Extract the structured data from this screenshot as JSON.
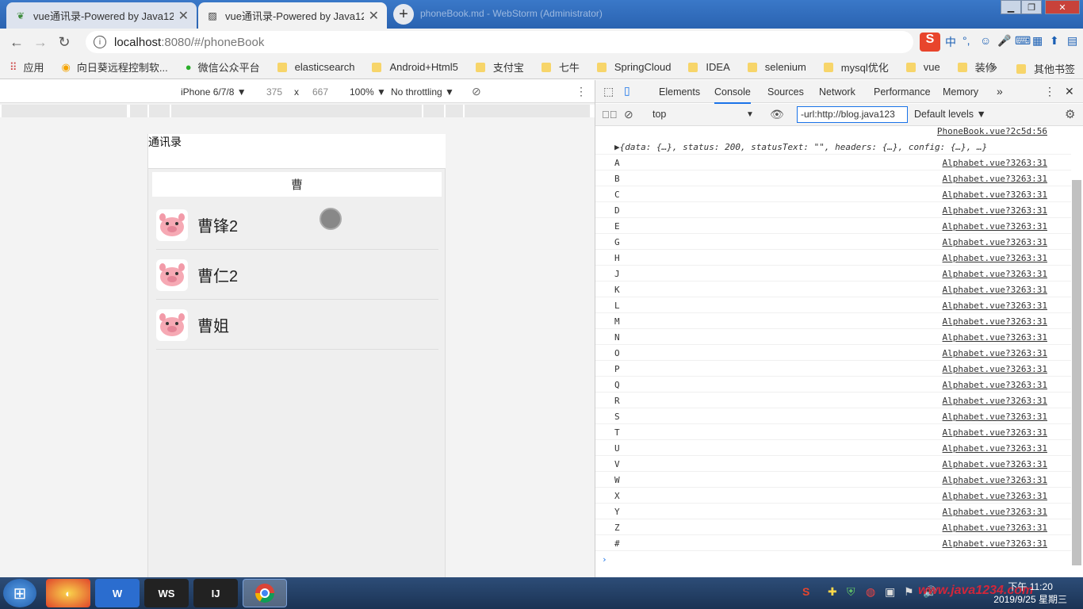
{
  "browser": {
    "tabs": [
      {
        "title": "vue通讯录-Powered by Java12",
        "active": false
      },
      {
        "title": "vue通讯录-Powered by Java12",
        "active": true
      }
    ],
    "new_tab": "+",
    "window_title": "phoneBook.md - WebStorm (Administrator)",
    "url_host": "localhost",
    "url_path": ":8080/#/phoneBook"
  },
  "bookmarks": [
    {
      "label": "应用",
      "icon": "apps-grid-icon"
    },
    {
      "label": "向日葵远程控制软...",
      "icon": "sunflower-icon"
    },
    {
      "label": "微信公众平台",
      "icon": "wechat-icon"
    },
    {
      "label": "elasticsearch",
      "icon": "folder-icon"
    },
    {
      "label": "Android+Html5",
      "icon": "folder-icon"
    },
    {
      "label": "支付宝",
      "icon": "folder-icon"
    },
    {
      "label": "七牛",
      "icon": "folder-icon"
    },
    {
      "label": "SpringCloud",
      "icon": "folder-icon"
    },
    {
      "label": "IDEA",
      "icon": "folder-icon"
    },
    {
      "label": "selenium",
      "icon": "folder-icon"
    },
    {
      "label": "mysql优化",
      "icon": "folder-icon"
    },
    {
      "label": "vue",
      "icon": "folder-icon"
    },
    {
      "label": "装修",
      "icon": "folder-icon"
    }
  ],
  "bookmarks_more": "»",
  "other_bookmarks": "其他书签",
  "device_toolbar": {
    "device": "iPhone 6/7/8 ▼",
    "width": "375",
    "times": "x",
    "height": "667",
    "zoom": "100% ▼",
    "throttle": "No throttling ▼"
  },
  "app": {
    "header": "通讯录",
    "group_letter": "曹",
    "contacts": [
      "曹锋2",
      "曹仁2",
      "曹姐"
    ]
  },
  "devtools": {
    "tabs": [
      "Elements",
      "Console",
      "Sources",
      "Network",
      "Performance",
      "Memory"
    ],
    "active_tab": "Console",
    "more": "»",
    "context": "top",
    "filter": "-url:http://blog.java123",
    "levels": "Default levels ▼",
    "header_source": "PhoneBook.vue?2c5d:56",
    "object_line": "▶{data: {…}, status: 200, statusText: \"\", headers: {…}, config: {…}, …}",
    "log_source": "Alphabet.vue?3263:31",
    "letters": [
      "A",
      "B",
      "C",
      "D",
      "E",
      "G",
      "H",
      "J",
      "K",
      "L",
      "M",
      "N",
      "O",
      "P",
      "Q",
      "R",
      "S",
      "T",
      "U",
      "V",
      "W",
      "X",
      "Y",
      "Z",
      "#"
    ],
    "prompt": "›"
  },
  "taskbar": {
    "clock_time": "下午 11:20",
    "clock_date": "2019/9/25 星期三",
    "watermark": "www.java1234.com"
  }
}
